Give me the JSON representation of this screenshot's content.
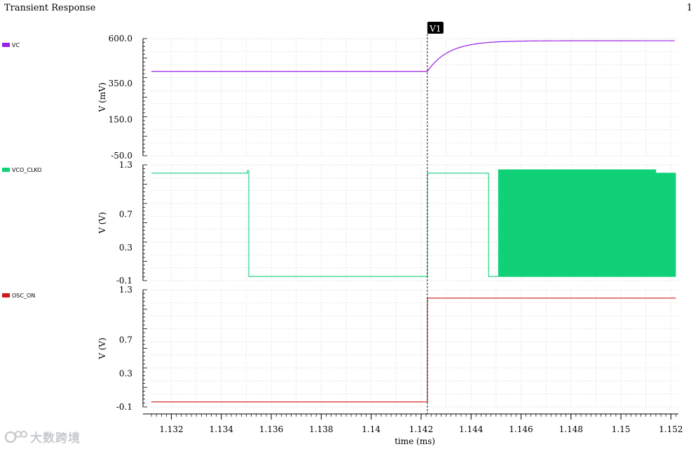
{
  "header": {
    "title": "Transient Response",
    "page_number": "1"
  },
  "watermark": {
    "text": "大数跨境",
    "logo_icon": "watermark-logo-icon"
  },
  "colors": {
    "VC": "#9b20e6",
    "VCO_CLKO": "#10d078",
    "OSC_ON": "#d01818",
    "grid": "#c8c8c8",
    "axis": "#000000"
  },
  "chart_data": {
    "type": "line",
    "title": "Transient Response",
    "xlabel": "time (ms)",
    "xlim": [
      1.1312,
      1.1523
    ],
    "x_ticks": [
      1.132,
      1.134,
      1.136,
      1.138,
      1.14,
      1.142,
      1.144,
      1.146,
      1.148,
      1.15,
      1.152
    ],
    "x_tick_labels": [
      "1.132",
      "1.134",
      "1.136",
      "1.138",
      "1.14",
      "1.142",
      "1.144",
      "1.146",
      "1.148",
      "1.15",
      "1.152"
    ],
    "grid": true,
    "legend_position": "left",
    "marker": {
      "label": "V1",
      "x": 1.14225
    },
    "panels": [
      {
        "name": "VC",
        "ylabel": "V (mV)",
        "ylim": [
          -50.0,
          600.0
        ],
        "y_tick_labels": [
          {
            "value": 600.0,
            "label": "600.0"
          },
          {
            "value": 350.0,
            "label": "350.0"
          },
          {
            "value": 150.0,
            "label": "150.0"
          },
          {
            "value": -50.0,
            "label": "-50.0"
          }
        ],
        "series": {
          "name": "VC",
          "model": "rc_step",
          "initial": 418,
          "final": 588,
          "step_time": 1.14225,
          "tau": 0.00085,
          "end": 1.1522
        }
      },
      {
        "name": "VCO_CLKO",
        "ylabel": "V (V)",
        "ylim": [
          -0.1,
          1.3
        ],
        "y_tick_labels": [
          {
            "value": 1.3,
            "label": "1.3"
          },
          {
            "value": 0.7,
            "label": "0.7"
          },
          {
            "value": 0.3,
            "label": "0.3"
          },
          {
            "value": -0.1,
            "label": "-0.1"
          }
        ],
        "series": {
          "name": "VCO_CLKO",
          "model": "digital",
          "high": 1.2,
          "low": -0.05,
          "points": [
            [
              1.1312,
              1.2
            ],
            [
              1.13505,
              1.2
            ],
            [
              1.13505,
              1.23
            ],
            [
              1.1351,
              1.23
            ],
            [
              1.1351,
              -0.05
            ],
            [
              1.14225,
              -0.05
            ],
            [
              1.14225,
              1.2
            ],
            [
              1.1447,
              1.2
            ],
            [
              1.1447,
              -0.05
            ],
            [
              1.1451,
              -0.05
            ]
          ],
          "oscillation": {
            "start": 1.1451,
            "end": 1.1522,
            "high": 1.24,
            "low": -0.05,
            "end_high": 1.2,
            "taper_start": 1.1514,
            "cycles": 190
          }
        }
      },
      {
        "name": "OSC_ON",
        "ylabel": "V (V)",
        "ylim": [
          -0.1,
          1.3
        ],
        "y_tick_labels": [
          {
            "value": 1.3,
            "label": "1.3"
          },
          {
            "value": 0.7,
            "label": "0.7"
          },
          {
            "value": 0.3,
            "label": "0.3"
          },
          {
            "value": -0.1,
            "label": "-0.1"
          }
        ],
        "series": {
          "name": "OSC_ON",
          "model": "digital",
          "points": [
            [
              1.1312,
              -0.04
            ],
            [
              1.14225,
              -0.04
            ],
            [
              1.14225,
              1.2
            ],
            [
              1.1522,
              1.2
            ]
          ]
        }
      }
    ]
  }
}
